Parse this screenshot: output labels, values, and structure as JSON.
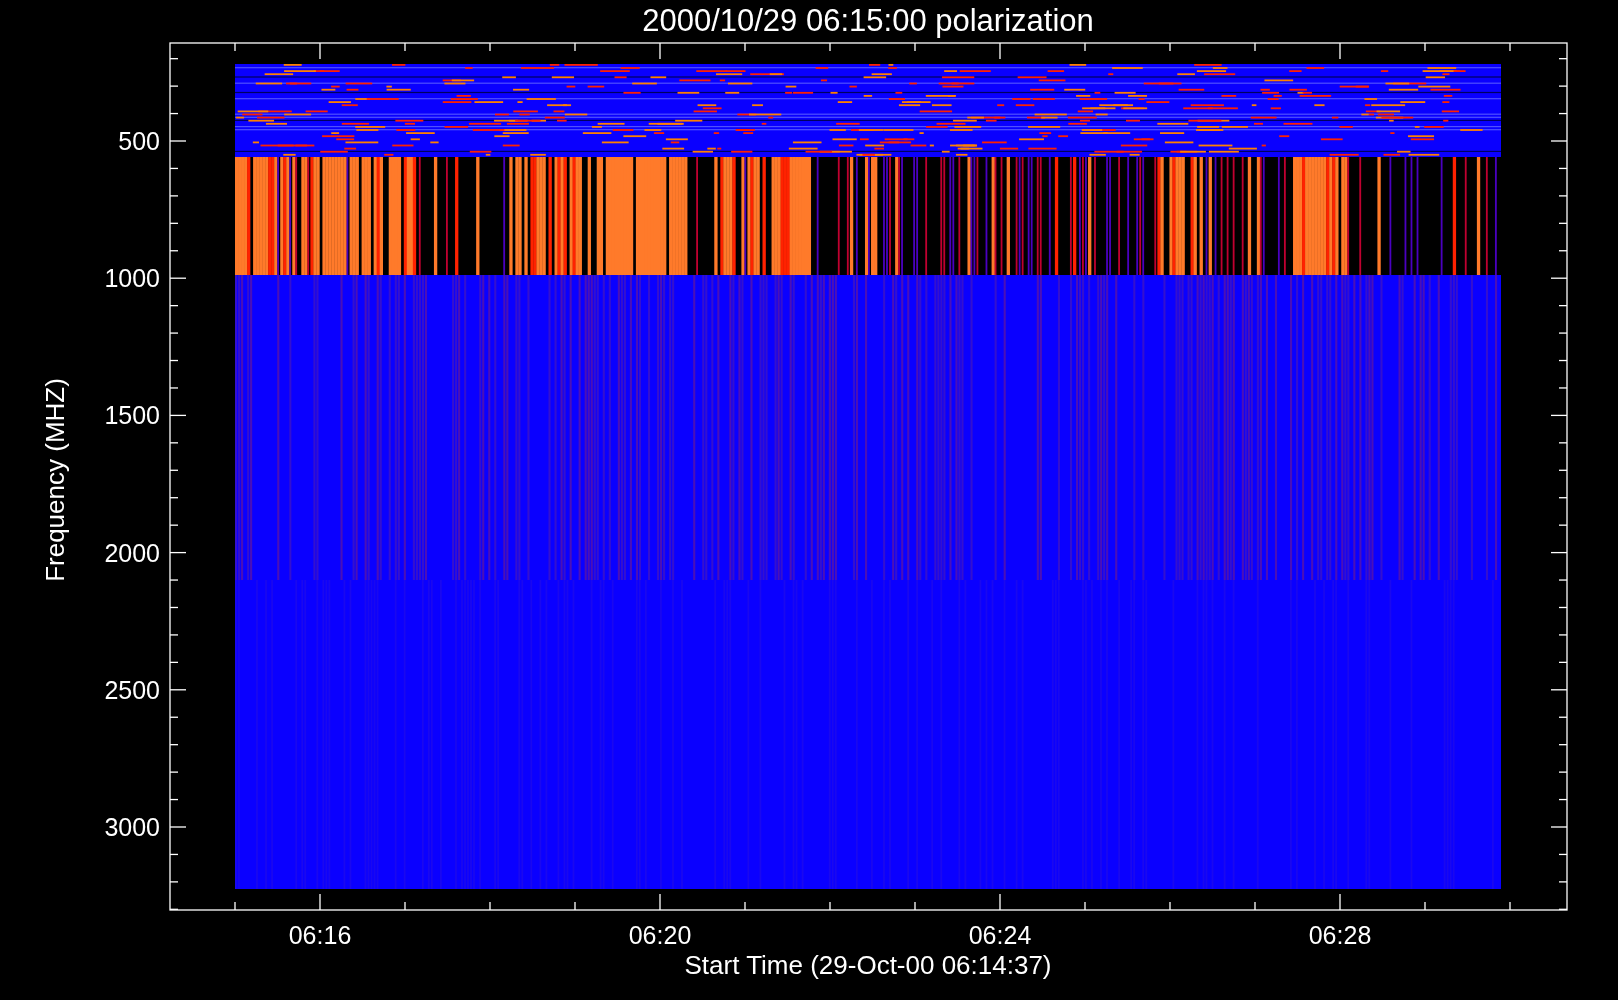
{
  "plot": {
    "title": "2000/10/29 06:15:00 polarization",
    "y_axis": {
      "label": "Frequency (MHZ)",
      "ticks": [
        "500",
        "1000",
        "1500",
        "2000",
        "2500",
        "3000"
      ]
    },
    "x_axis": {
      "label": "Start Time (29-Oct-00 06:14:37)",
      "ticks": [
        "06:16",
        "06:20",
        "06:24",
        "06:28"
      ]
    }
  }
}
